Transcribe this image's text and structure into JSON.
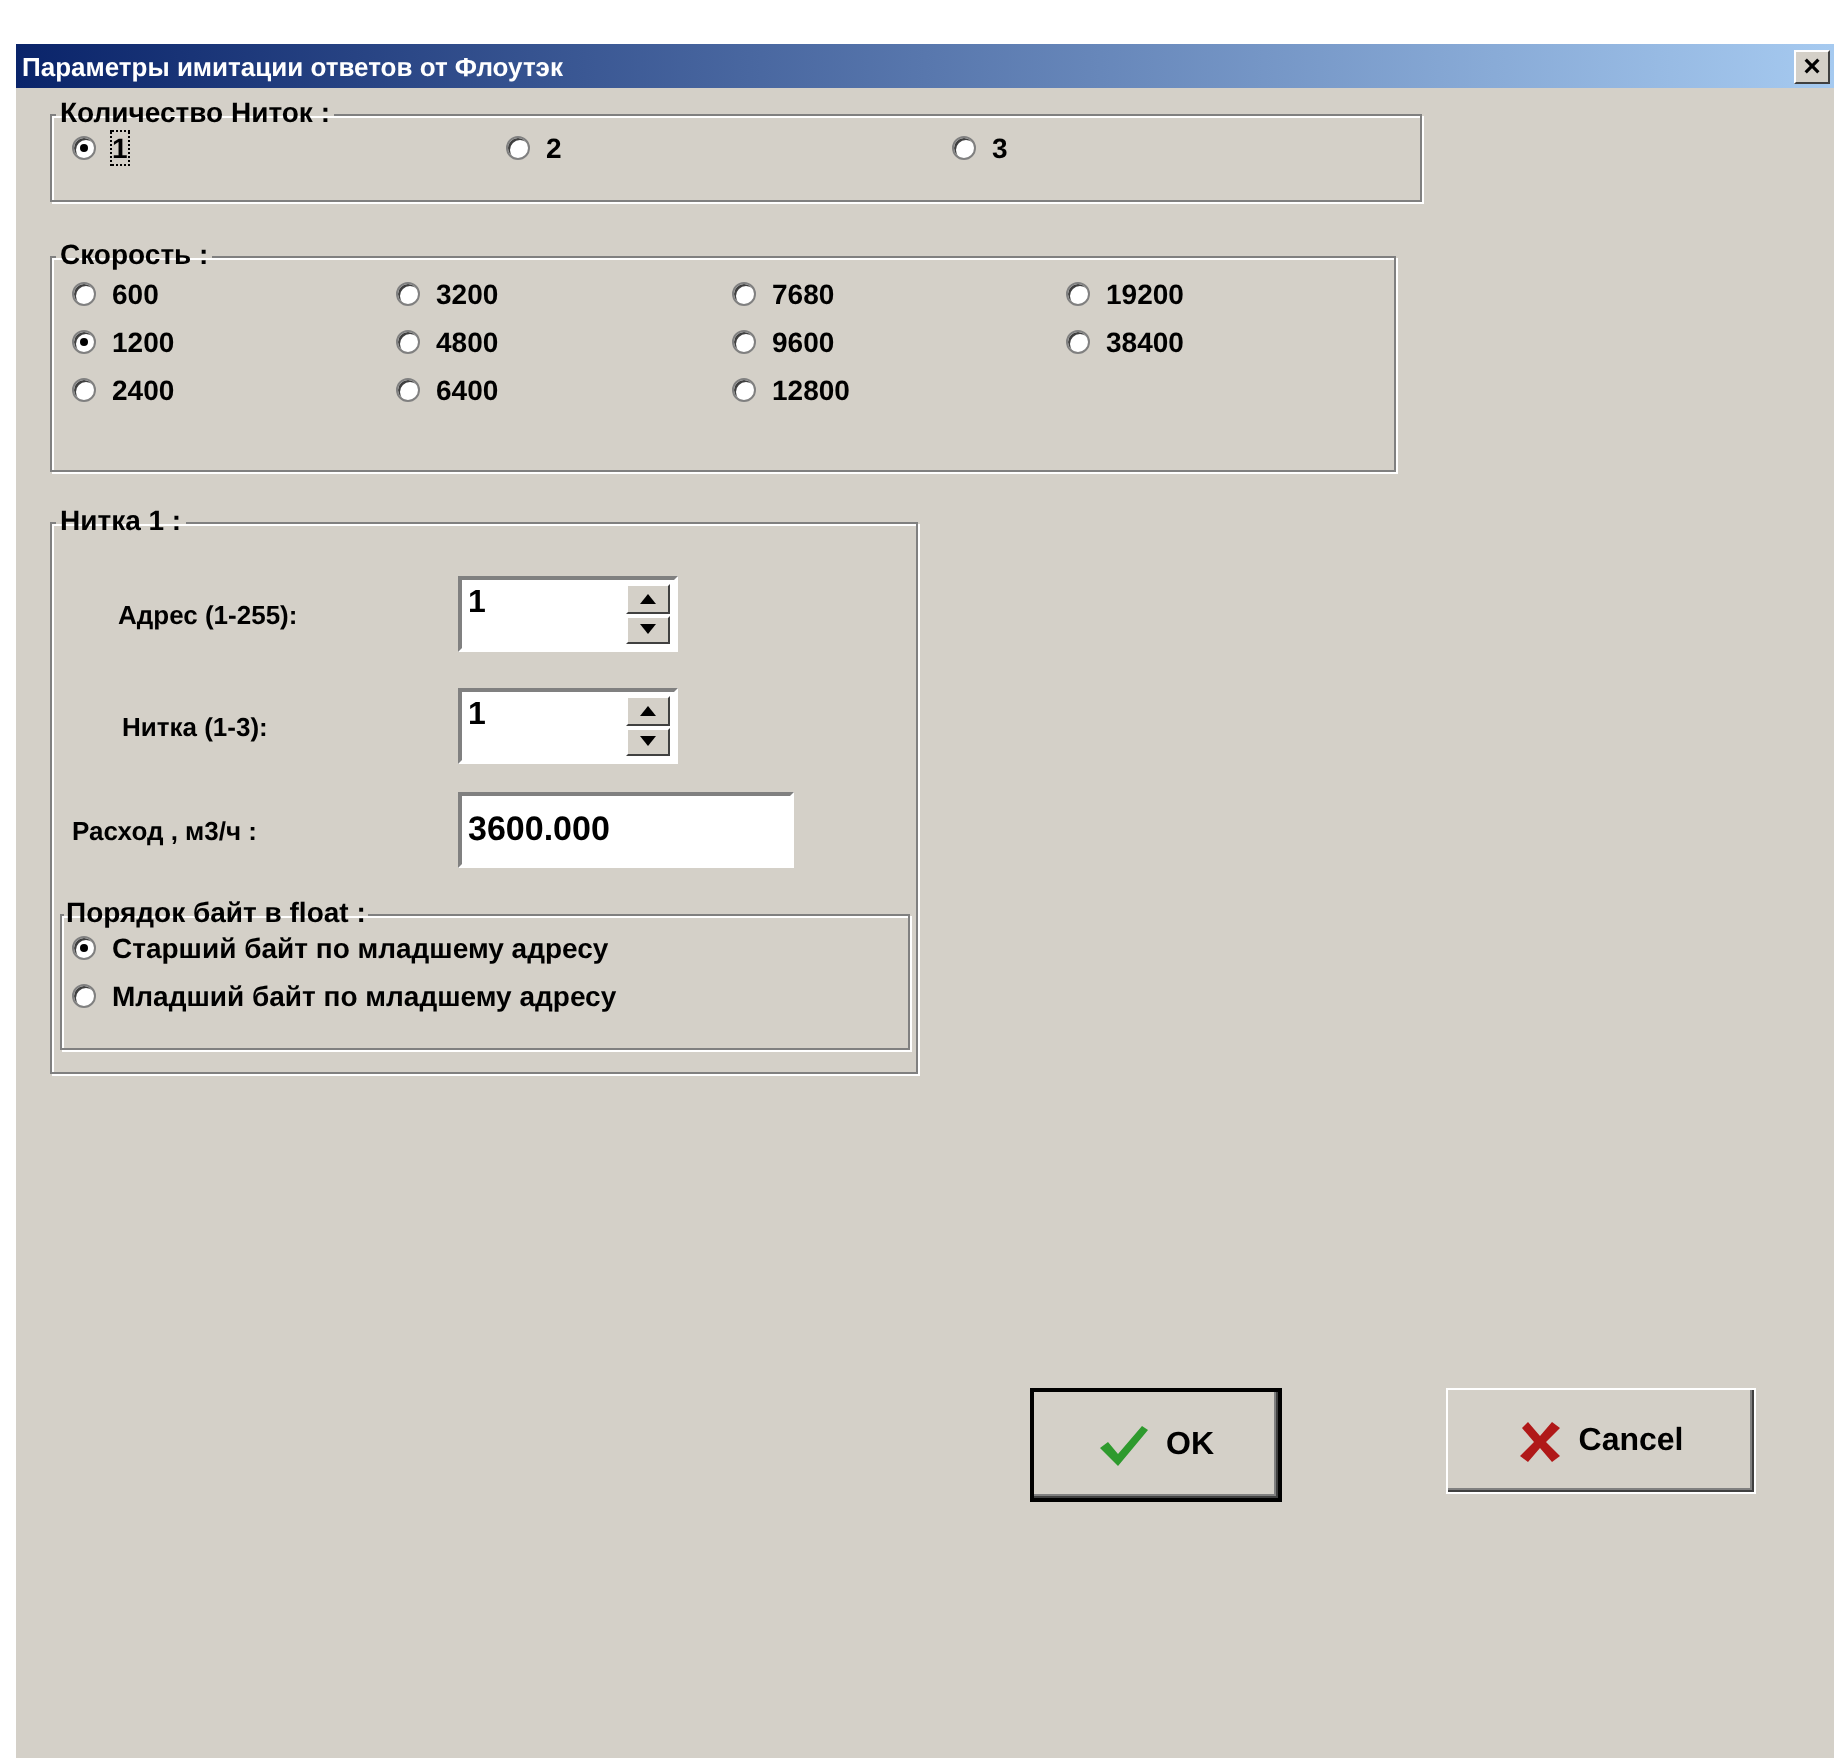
{
  "window": {
    "title": "Параметры имитации ответов от Флоутэк",
    "close": "×"
  },
  "thread_count": {
    "label": "Количество Ниток :",
    "options": [
      {
        "label": "1",
        "selected": true,
        "focused": true
      },
      {
        "label": "2",
        "selected": false,
        "focused": false
      },
      {
        "label": "3",
        "selected": false,
        "focused": false
      }
    ]
  },
  "speed": {
    "label": "Скорость :",
    "options": [
      {
        "label": "600",
        "selected": false
      },
      {
        "label": "3200",
        "selected": false
      },
      {
        "label": "7680",
        "selected": false
      },
      {
        "label": "19200",
        "selected": false
      },
      {
        "label": "1200",
        "selected": true
      },
      {
        "label": "4800",
        "selected": false
      },
      {
        "label": "9600",
        "selected": false
      },
      {
        "label": "38400",
        "selected": false
      },
      {
        "label": "2400",
        "selected": false
      },
      {
        "label": "6400",
        "selected": false
      },
      {
        "label": "12800",
        "selected": false
      }
    ]
  },
  "thread": {
    "label": "Нитка 1 :",
    "fields": [
      {
        "kind": "spin",
        "label": "Адрес (1-255):",
        "value": "1"
      },
      {
        "kind": "spin",
        "label": "Нитка (1-3):",
        "value": "1"
      },
      {
        "kind": "text",
        "label": "Расход , м3/ч :",
        "value": "3600.000"
      }
    ],
    "byte_order": {
      "label": "Порядок байт в float :",
      "options": [
        {
          "label": "Старший байт по младшему адресу",
          "selected": true
        },
        {
          "label": "Младший байт по младшему адресу",
          "selected": false
        }
      ]
    }
  },
  "buttons": [
    {
      "kind": "ok",
      "label": "OK",
      "default": true
    },
    {
      "kind": "cancel",
      "label": "Cancel",
      "default": false
    }
  ]
}
